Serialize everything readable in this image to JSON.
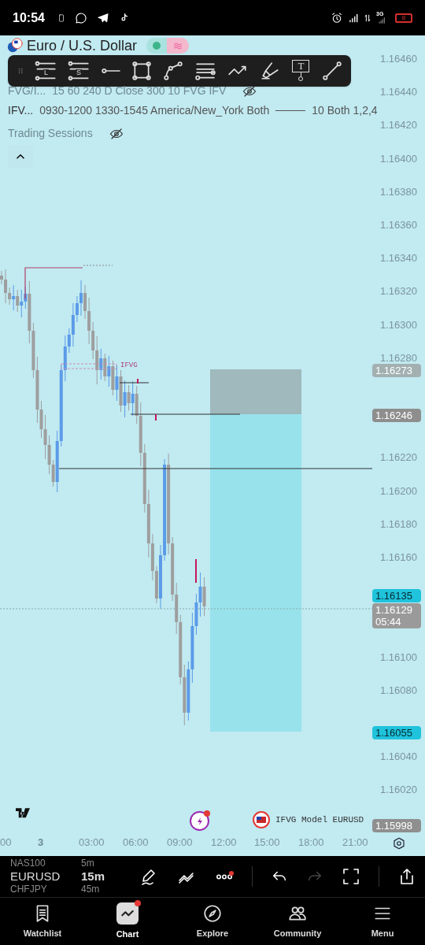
{
  "status_bar": {
    "time": "10:54",
    "network": "3G",
    "battery": "8"
  },
  "header": {
    "symbol": "Euro / U.S. Dollar"
  },
  "drawing_toolbar": {
    "long_label": "L",
    "short_label": "S",
    "text_label": "T"
  },
  "indicators": [
    {
      "name": "FVG/I...",
      "params": "15 60 240 D Close 300 10 FVG IFV",
      "hidden": true
    },
    {
      "name": "IFV...",
      "params": "0930-1200 1330-1545 America/New_York Both",
      "extra": "10 Both 1,2,4",
      "hidden": false
    },
    {
      "name": "Trading Sessions",
      "hidden": true
    }
  ],
  "price_axis": {
    "ticks": [
      "1.16460",
      "1.16440",
      "1.16420",
      "1.16400",
      "1.16380",
      "1.16360",
      "1.16340",
      "1.16320",
      "1.16300",
      "1.16280",
      "1.16220",
      "1.16200",
      "1.16180",
      "1.16160",
      "1.16100",
      "1.16080",
      "1.16040",
      "1.16020"
    ],
    "badges": [
      {
        "text": "1.16273",
        "kind": "stop"
      },
      {
        "text": "1.16246",
        "kind": "entry"
      },
      {
        "text": "1.16135",
        "kind": "bid"
      },
      {
        "text": "1.16129",
        "countdown": "05:44",
        "kind": "last"
      },
      {
        "text": "1.16055",
        "kind": "target"
      },
      {
        "text": "1.15998",
        "kind": "low"
      }
    ]
  },
  "chart_labels": {
    "fvg_label": "IFVG",
    "script_name": "IFVG Model EURUSD"
  },
  "time_axis": [
    {
      "text": "00",
      "kind": "time"
    },
    {
      "text": "3",
      "kind": "day"
    },
    {
      "text": "03:00",
      "kind": "time"
    },
    {
      "text": "06:00",
      "kind": "time"
    },
    {
      "text": "09:00",
      "kind": "time"
    },
    {
      "text": "12:00",
      "kind": "time"
    },
    {
      "text": "15:00",
      "kind": "time"
    },
    {
      "text": "18:00",
      "kind": "time"
    },
    {
      "text": "21:00",
      "kind": "time"
    }
  ],
  "symbol_picker": [
    {
      "symbol": "NAS100",
      "interval": "5m",
      "selected": false
    },
    {
      "symbol": "EURUSD",
      "interval": "15m",
      "selected": true
    },
    {
      "symbol": "CHFJPY",
      "interval": "45m",
      "selected": false
    }
  ],
  "chart_toolbar": {
    "redo_disabled": true,
    "more_badge": true
  },
  "nav": [
    {
      "label": "Watchlist",
      "selected": false,
      "badge": false
    },
    {
      "label": "Chart",
      "selected": true,
      "badge": true
    },
    {
      "label": "Explore",
      "selected": false,
      "badge": false
    },
    {
      "label": "Community",
      "selected": false,
      "badge": false
    },
    {
      "label": "Menu",
      "selected": false,
      "badge": false
    }
  ]
}
